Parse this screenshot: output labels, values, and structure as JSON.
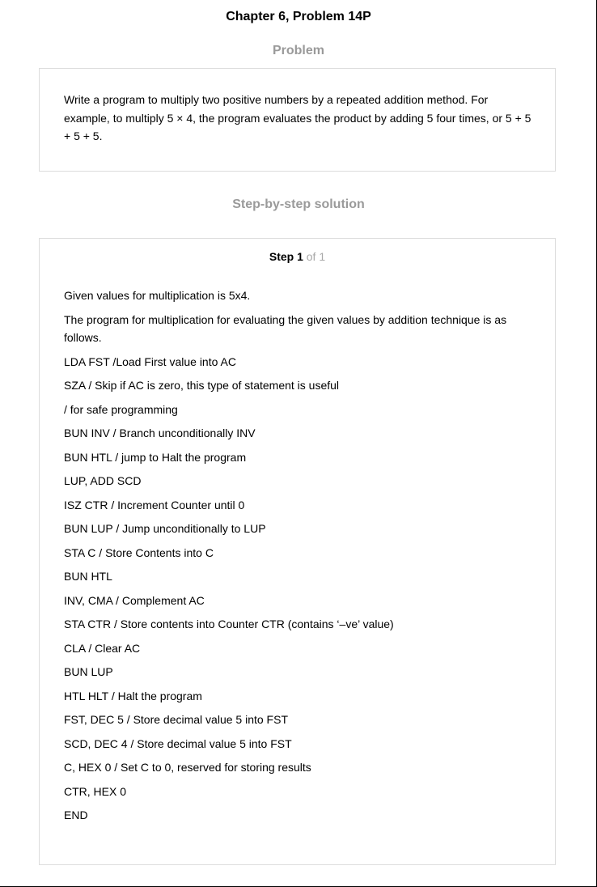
{
  "header": {
    "chapter_title": "Chapter 6, Problem 14P"
  },
  "problem": {
    "heading": "Problem",
    "text": "Write a program to multiply two positive numbers by a repeated addition method. For example, to multiply 5 × 4, the program evaluates the product by adding 5 four times, or 5 + 5 + 5 + 5."
  },
  "solution": {
    "heading": "Step-by-step solution",
    "step_label": "Step 1",
    "step_of": "of 1",
    "lines": [
      "Given values for multiplication is 5x4.",
      "The program for multiplication for evaluating the given values by addition technique is as follows.",
      "LDA FST /Load First value into AC",
      "SZA / Skip if AC is zero, this type of statement is useful",
      "/ for safe programming",
      "BUN INV / Branch unconditionally INV",
      "BUN HTL / jump to Halt the program",
      "LUP, ADD SCD",
      "ISZ CTR / Increment Counter until 0",
      "BUN LUP / Jump unconditionally to LUP",
      "STA C / Store Contents into C",
      "BUN HTL",
      "INV, CMA / Complement AC",
      "STA CTR / Store contents into Counter CTR (contains ‘–ve’ value)",
      "CLA / Clear AC",
      "BUN LUP",
      "HTL HLT / Halt the program",
      "FST, DEC 5 / Store decimal value 5 into FST",
      "SCD, DEC 4 / Store decimal value 5 into FST",
      "C, HEX 0 / Set C to 0, reserved for storing results",
      "CTR, HEX 0",
      "END"
    ]
  }
}
